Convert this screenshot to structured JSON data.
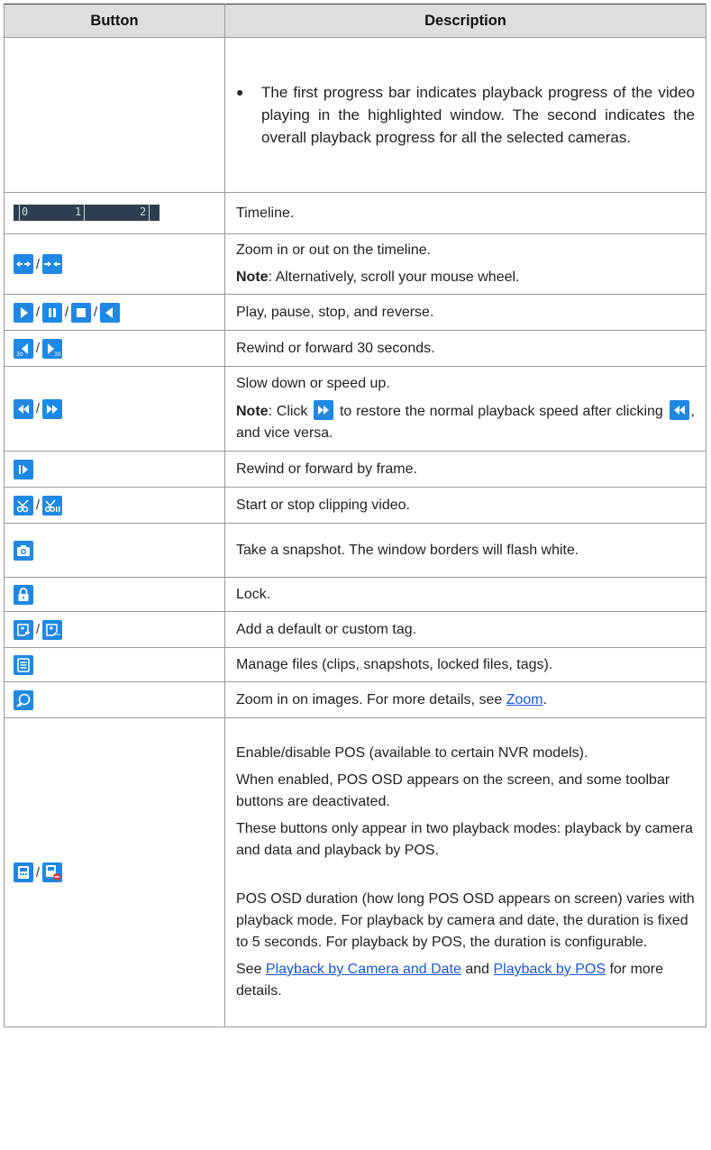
{
  "header": {
    "col1": "Button",
    "col2": "Description"
  },
  "rows": {
    "progress": {
      "bullet_text": "The first progress bar indicates playback progress of the video playing in the highlighted window. The second indicates the overall playback progress for all the selected cameras."
    },
    "timeline": {
      "labels": [
        "0",
        "1",
        "2"
      ],
      "desc": "Timeline."
    },
    "zoom_timeline": {
      "desc": "Zoom in or out on the timeline.",
      "note_label": "Note",
      "note_text": ": Alternatively, scroll your mouse wheel."
    },
    "play": {
      "desc": "Play, pause, stop, and reverse."
    },
    "rewind30": {
      "desc": "Rewind or forward 30 seconds."
    },
    "speed": {
      "desc": "Slow down or speed up.",
      "note_label": "Note",
      "note_text_1": ": Click ",
      "note_text_2": " to restore the normal playback speed after clicking ",
      "note_text_3": ", and vice versa."
    },
    "frame": {
      "desc": "Rewind or forward by frame."
    },
    "clip": {
      "desc": "Start or stop clipping video."
    },
    "snapshot": {
      "desc": "Take a snapshot. The window borders will flash white."
    },
    "lock": {
      "desc": "Lock."
    },
    "tag": {
      "desc": "Add a default or custom tag."
    },
    "files": {
      "desc": "Manage files (clips, snapshots, locked files, tags)."
    },
    "zoom_image": {
      "desc_prefix": "Zoom in on images. For more details, see ",
      "link": "Zoom",
      "desc_suffix": "."
    },
    "pos": {
      "p1": "Enable/disable POS (available to certain NVR models).",
      "p2": "When enabled, POS OSD appears on the screen, and some toolbar buttons are deactivated.",
      "p3": "These buttons only appear in two playback modes: playback by camera and data and playback by POS.",
      "p4": "POS OSD duration (how long POS OSD appears on screen) varies with playback mode. For playback by camera and date, the duration is fixed to 5 seconds. For playback by POS, the duration is configurable.",
      "p5_prefix": "See ",
      "link1": "Playback by Camera and Date",
      "p5_mid": " and ",
      "link2": "Playback by POS",
      "p5_suffix": " for more details."
    }
  },
  "slash": "/",
  "colors": {
    "button_blue": "#1e88e5",
    "header_bg": "#dedede",
    "link": "#1a55d8",
    "timeline_bg": "#2c3e50"
  }
}
